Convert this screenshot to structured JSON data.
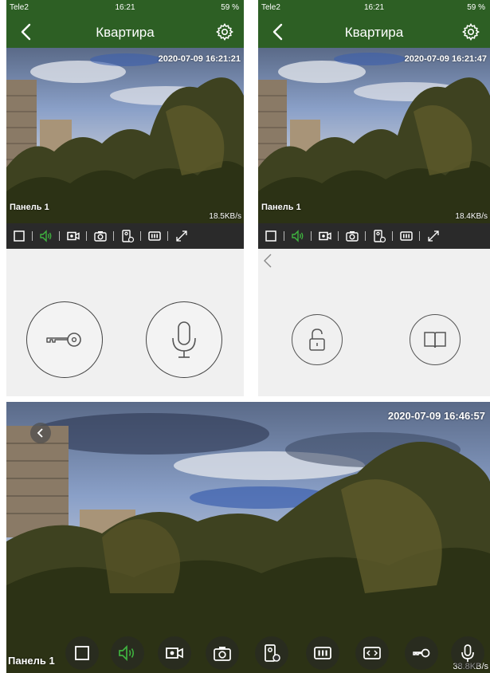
{
  "colors": {
    "header_green": "#2d5f24",
    "accent_green": "#3fb33f",
    "toolbar_dark": "#2a2a2a",
    "icon_white": "#ffffff"
  },
  "screen_left": {
    "status": {
      "carrier": "Tele2",
      "time": "16:21",
      "battery": "59 %"
    },
    "title": "Квартира",
    "timestamp": "2020-07-09 16:21:21",
    "panel_label": "Панель 1",
    "speed": "18.5KB/s",
    "toolbar_icons": [
      "fullscreen-square-icon",
      "speaker-icon",
      "record-video-icon",
      "snapshot-camera-icon",
      "intercom-panel-icon",
      "stream-quality-icon",
      "expand-icon"
    ],
    "actions": [
      "key-unlock-icon",
      "microphone-icon"
    ]
  },
  "screen_right": {
    "status": {
      "carrier": "Tele2",
      "time": "16:21",
      "battery": "59 %"
    },
    "title": "Квартира",
    "timestamp": "2020-07-09 16:21:47",
    "panel_label": "Панель 1",
    "speed": "18.4KB/s",
    "toolbar_icons": [
      "fullscreen-square-icon",
      "speaker-icon",
      "record-video-icon",
      "snapshot-camera-icon",
      "intercom-panel-icon",
      "stream-quality-icon",
      "expand-icon"
    ],
    "actions": [
      "padlock-open-icon",
      "book-icon"
    ]
  },
  "landscape": {
    "timestamp": "2020-07-09 16:46:57",
    "panel_label": "Панель 1",
    "speed": "38.8KB/s",
    "controls": [
      "fullscreen-square-icon",
      "speaker-icon",
      "record-video-icon",
      "snapshot-camera-icon",
      "intercom-panel-icon",
      "stream-quality-icon",
      "fit-screen-icon",
      "key-unlock-icon",
      "microphone-icon"
    ]
  }
}
